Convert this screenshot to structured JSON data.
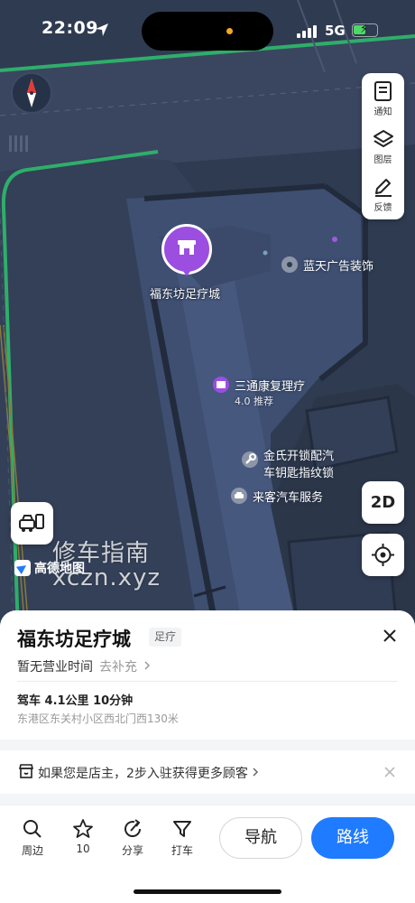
{
  "status_bar": {
    "time": "22:09",
    "network": "5G"
  },
  "map": {
    "tools": [
      {
        "label": "通知",
        "icon": "notification-icon"
      },
      {
        "label": "图层",
        "icon": "layers-icon"
      },
      {
        "label": "反馈",
        "icon": "feedback-edit-icon"
      }
    ],
    "view_mode": "2D",
    "logo_text": "高德地图",
    "watermark": [
      "修车指南",
      "xczn.xyz"
    ],
    "selected_pin_label": "福东坊足疗城",
    "pois": [
      {
        "name": "蓝天广告装饰",
        "icon": "place-dot-icon"
      },
      {
        "name": "三通康复理疗",
        "sub": "4.0 推荐",
        "icon": "spa-icon"
      },
      {
        "name": "金氏开锁配汽车钥匙指纹锁",
        "line1": "金氏开锁配汽",
        "line2": "车钥匙指纹锁",
        "icon": "wrench-icon"
      },
      {
        "name": "来客汽车服务",
        "icon": "car-service-icon"
      }
    ]
  },
  "place": {
    "name": "福东坊足疗城",
    "category": "足疗",
    "hours": "暂无营业时间",
    "supplement": "去补充",
    "drive_info": "驾车 4.1公里 10分钟",
    "address": "东港区东关村小区西北门西130米"
  },
  "owner_banner": {
    "text": "如果您是店主，2步入驻获得更多顾客"
  },
  "actions": {
    "nearby": "周边",
    "favorites": "10",
    "share": "分享",
    "taxi": "打车",
    "navigate": "导航",
    "route": "路线"
  },
  "colors": {
    "accent": "#1f7bff",
    "pin": "#9c4ee0",
    "map_bg": "#2f3b50",
    "road_edge": "#2fae6a"
  }
}
